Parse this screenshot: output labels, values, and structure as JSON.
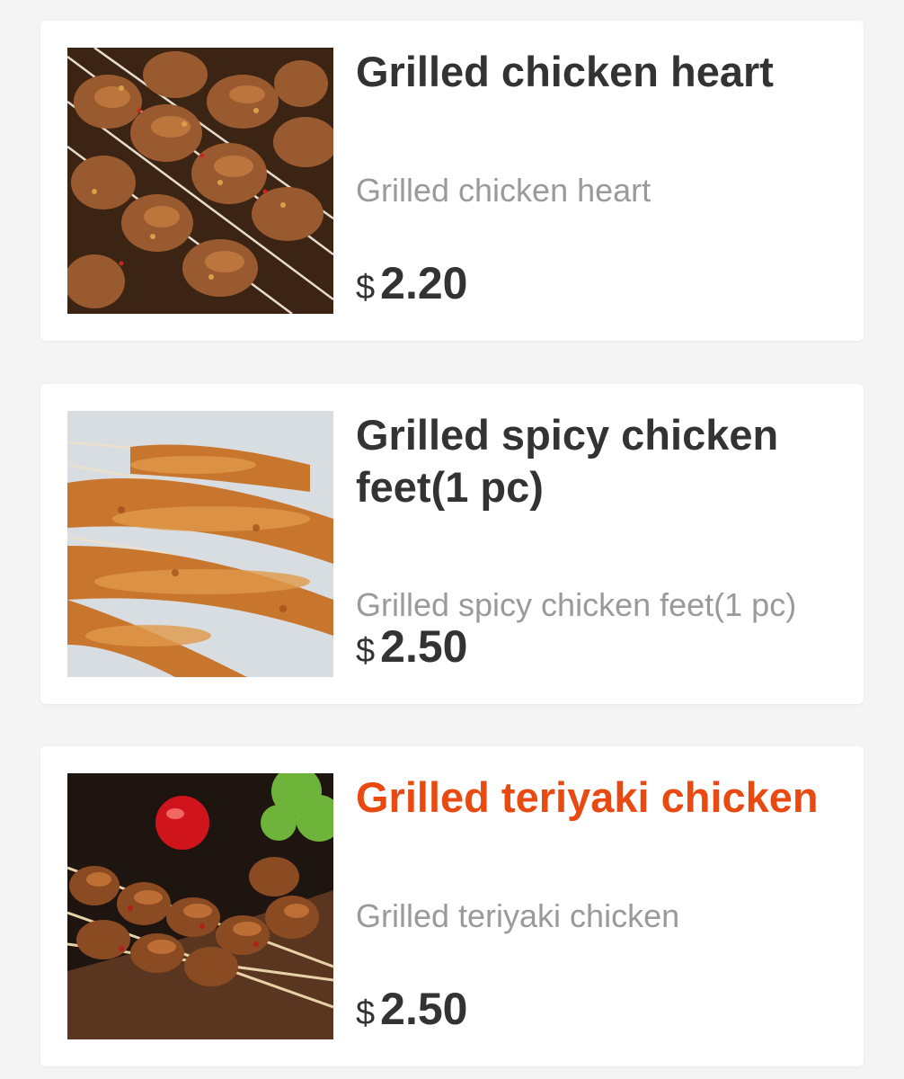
{
  "items": [
    {
      "title": "Grilled chicken heart",
      "description": "Grilled chicken heart",
      "currency": "$",
      "price": "2.20",
      "image": "grilled-chicken-heart-photo"
    },
    {
      "title": "Grilled spicy chicken feet(1 pc)",
      "description": "Grilled spicy chicken feet(1 pc)",
      "currency": "$",
      "price": "2.50",
      "image": "grilled-chicken-feet-photo"
    },
    {
      "title": "Grilled teriyaki chicken",
      "description": "Grilled teriyaki chicken",
      "currency": "$",
      "price": "2.50",
      "image": "grilled-teriyaki-chicken-photo"
    }
  ],
  "colors": {
    "background": "#f4f4f4",
    "card": "#ffffff",
    "title": "#333333",
    "title_active": "#e84a12",
    "description": "#9a9a9a"
  }
}
